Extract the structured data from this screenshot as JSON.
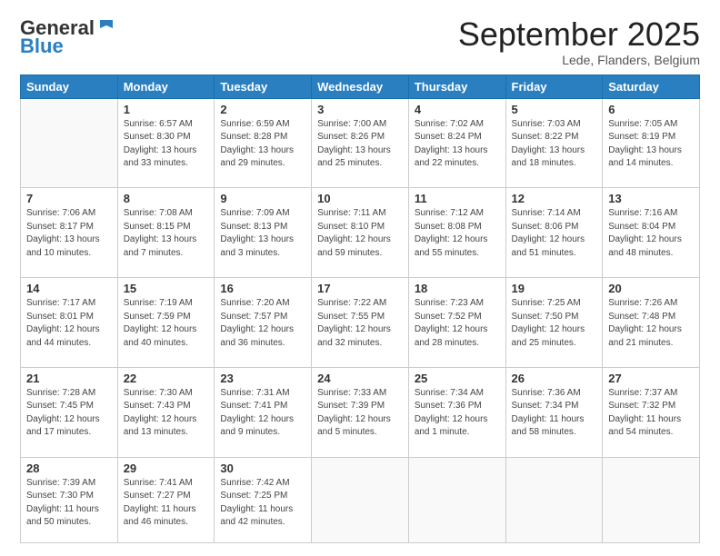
{
  "header": {
    "logo_general": "General",
    "logo_blue": "Blue",
    "month_title": "September 2025",
    "location": "Lede, Flanders, Belgium"
  },
  "weekdays": [
    "Sunday",
    "Monday",
    "Tuesday",
    "Wednesday",
    "Thursday",
    "Friday",
    "Saturday"
  ],
  "weeks": [
    [
      {
        "day": "",
        "info": ""
      },
      {
        "day": "1",
        "info": "Sunrise: 6:57 AM\nSunset: 8:30 PM\nDaylight: 13 hours\nand 33 minutes."
      },
      {
        "day": "2",
        "info": "Sunrise: 6:59 AM\nSunset: 8:28 PM\nDaylight: 13 hours\nand 29 minutes."
      },
      {
        "day": "3",
        "info": "Sunrise: 7:00 AM\nSunset: 8:26 PM\nDaylight: 13 hours\nand 25 minutes."
      },
      {
        "day": "4",
        "info": "Sunrise: 7:02 AM\nSunset: 8:24 PM\nDaylight: 13 hours\nand 22 minutes."
      },
      {
        "day": "5",
        "info": "Sunrise: 7:03 AM\nSunset: 8:22 PM\nDaylight: 13 hours\nand 18 minutes."
      },
      {
        "day": "6",
        "info": "Sunrise: 7:05 AM\nSunset: 8:19 PM\nDaylight: 13 hours\nand 14 minutes."
      }
    ],
    [
      {
        "day": "7",
        "info": "Sunrise: 7:06 AM\nSunset: 8:17 PM\nDaylight: 13 hours\nand 10 minutes."
      },
      {
        "day": "8",
        "info": "Sunrise: 7:08 AM\nSunset: 8:15 PM\nDaylight: 13 hours\nand 7 minutes."
      },
      {
        "day": "9",
        "info": "Sunrise: 7:09 AM\nSunset: 8:13 PM\nDaylight: 13 hours\nand 3 minutes."
      },
      {
        "day": "10",
        "info": "Sunrise: 7:11 AM\nSunset: 8:10 PM\nDaylight: 12 hours\nand 59 minutes."
      },
      {
        "day": "11",
        "info": "Sunrise: 7:12 AM\nSunset: 8:08 PM\nDaylight: 12 hours\nand 55 minutes."
      },
      {
        "day": "12",
        "info": "Sunrise: 7:14 AM\nSunset: 8:06 PM\nDaylight: 12 hours\nand 51 minutes."
      },
      {
        "day": "13",
        "info": "Sunrise: 7:16 AM\nSunset: 8:04 PM\nDaylight: 12 hours\nand 48 minutes."
      }
    ],
    [
      {
        "day": "14",
        "info": "Sunrise: 7:17 AM\nSunset: 8:01 PM\nDaylight: 12 hours\nand 44 minutes."
      },
      {
        "day": "15",
        "info": "Sunrise: 7:19 AM\nSunset: 7:59 PM\nDaylight: 12 hours\nand 40 minutes."
      },
      {
        "day": "16",
        "info": "Sunrise: 7:20 AM\nSunset: 7:57 PM\nDaylight: 12 hours\nand 36 minutes."
      },
      {
        "day": "17",
        "info": "Sunrise: 7:22 AM\nSunset: 7:55 PM\nDaylight: 12 hours\nand 32 minutes."
      },
      {
        "day": "18",
        "info": "Sunrise: 7:23 AM\nSunset: 7:52 PM\nDaylight: 12 hours\nand 28 minutes."
      },
      {
        "day": "19",
        "info": "Sunrise: 7:25 AM\nSunset: 7:50 PM\nDaylight: 12 hours\nand 25 minutes."
      },
      {
        "day": "20",
        "info": "Sunrise: 7:26 AM\nSunset: 7:48 PM\nDaylight: 12 hours\nand 21 minutes."
      }
    ],
    [
      {
        "day": "21",
        "info": "Sunrise: 7:28 AM\nSunset: 7:45 PM\nDaylight: 12 hours\nand 17 minutes."
      },
      {
        "day": "22",
        "info": "Sunrise: 7:30 AM\nSunset: 7:43 PM\nDaylight: 12 hours\nand 13 minutes."
      },
      {
        "day": "23",
        "info": "Sunrise: 7:31 AM\nSunset: 7:41 PM\nDaylight: 12 hours\nand 9 minutes."
      },
      {
        "day": "24",
        "info": "Sunrise: 7:33 AM\nSunset: 7:39 PM\nDaylight: 12 hours\nand 5 minutes."
      },
      {
        "day": "25",
        "info": "Sunrise: 7:34 AM\nSunset: 7:36 PM\nDaylight: 12 hours\nand 1 minute."
      },
      {
        "day": "26",
        "info": "Sunrise: 7:36 AM\nSunset: 7:34 PM\nDaylight: 11 hours\nand 58 minutes."
      },
      {
        "day": "27",
        "info": "Sunrise: 7:37 AM\nSunset: 7:32 PM\nDaylight: 11 hours\nand 54 minutes."
      }
    ],
    [
      {
        "day": "28",
        "info": "Sunrise: 7:39 AM\nSunset: 7:30 PM\nDaylight: 11 hours\nand 50 minutes."
      },
      {
        "day": "29",
        "info": "Sunrise: 7:41 AM\nSunset: 7:27 PM\nDaylight: 11 hours\nand 46 minutes."
      },
      {
        "day": "30",
        "info": "Sunrise: 7:42 AM\nSunset: 7:25 PM\nDaylight: 11 hours\nand 42 minutes."
      },
      {
        "day": "",
        "info": ""
      },
      {
        "day": "",
        "info": ""
      },
      {
        "day": "",
        "info": ""
      },
      {
        "day": "",
        "info": ""
      }
    ]
  ]
}
